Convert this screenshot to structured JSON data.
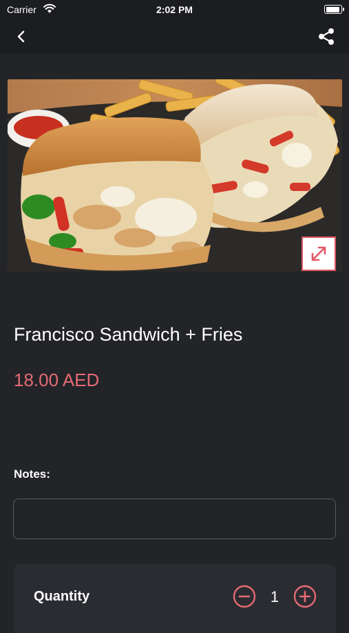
{
  "status_bar": {
    "carrier": "Carrier",
    "time": "2:02 PM",
    "battery_level": 0.95
  },
  "nav": {
    "back_icon": "chevron-left-icon",
    "share_icon": "share-icon"
  },
  "product": {
    "image_alt": "sandwich-and-fries-photo",
    "expand_icon": "expand-icon",
    "title": "Francisco Sandwich + Fries",
    "price": "18.00 AED"
  },
  "notes": {
    "label": "Notes:",
    "value": "",
    "placeholder": ""
  },
  "quantity": {
    "label": "Quantity",
    "value": "1",
    "minus_icon": "minus-circle-icon",
    "plus_icon": "plus-circle-icon"
  },
  "colors": {
    "accent": "#e56a74",
    "background": "#232428",
    "nav_background": "#1c1d20",
    "card_background": "#2b2c31"
  }
}
